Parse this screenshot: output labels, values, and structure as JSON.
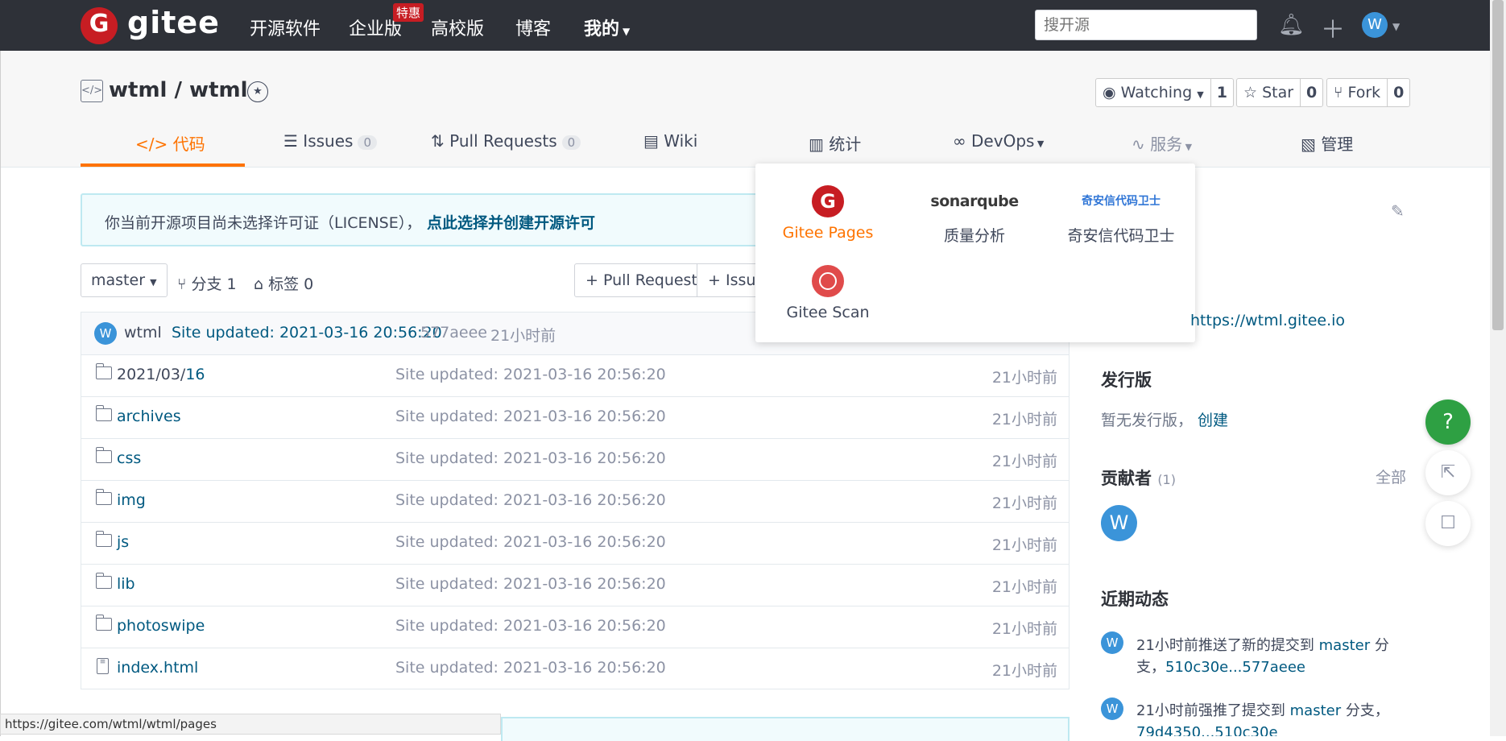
{
  "topbar": {
    "logo_letter": "G",
    "logo_text": "gitee",
    "nav": [
      "开源软件",
      "企业版",
      "高校版",
      "博客",
      "我的"
    ],
    "hot_badge": "特惠",
    "search_placeholder": "搜开源",
    "avatar_letter": "W"
  },
  "repo": {
    "title": "wtml / wtml",
    "watching_label": "Watching",
    "watching_count": "1",
    "star_label": "Star",
    "star_count": "0",
    "fork_label": "Fork",
    "fork_count": "0"
  },
  "tabs": [
    {
      "label": "代码",
      "icon": "code-icon"
    },
    {
      "label": "Issues",
      "count": "0"
    },
    {
      "label": "Pull Requests",
      "count": "0"
    },
    {
      "label": "Wiki"
    },
    {
      "label": "统计"
    },
    {
      "label": "DevOps"
    },
    {
      "label": "服务"
    },
    {
      "label": "管理"
    }
  ],
  "notice": {
    "text": "你当前开源项目尚未选择许可证（LICENSE），",
    "link": "点此选择并创建开源许可"
  },
  "branch": {
    "current": "master",
    "branches": "分支 1",
    "tags": "标签 0",
    "pr_button": "+ Pull Request",
    "issue_button": "+ Issue"
  },
  "commit": {
    "avatar": "W",
    "author": "wtml",
    "message": "Site updated: 2021-03-16 20:56:20",
    "hash": "577aeee",
    "time": "21小时前"
  },
  "files": [
    {
      "name_prefix": "2021/03/",
      "name": "16",
      "type": "folder",
      "message": "Site updated: 2021-03-16 20:56:20",
      "time": "21小时前"
    },
    {
      "name_prefix": "",
      "name": "archives",
      "type": "folder",
      "message": "Site updated: 2021-03-16 20:56:20",
      "time": "21小时前"
    },
    {
      "name_prefix": "",
      "name": "css",
      "type": "folder",
      "message": "Site updated: 2021-03-16 20:56:20",
      "time": "21小时前"
    },
    {
      "name_prefix": "",
      "name": "img",
      "type": "folder",
      "message": "Site updated: 2021-03-16 20:56:20",
      "time": "21小时前"
    },
    {
      "name_prefix": "",
      "name": "js",
      "type": "folder",
      "message": "Site updated: 2021-03-16 20:56:20",
      "time": "21小时前"
    },
    {
      "name_prefix": "",
      "name": "lib",
      "type": "folder",
      "message": "Site updated: 2021-03-16 20:56:20",
      "time": "21小时前"
    },
    {
      "name_prefix": "",
      "name": "photoswipe",
      "type": "folder",
      "message": "Site updated: 2021-03-16 20:56:20",
      "time": "21小时前"
    },
    {
      "name_prefix": "",
      "name": "index.html",
      "type": "file",
      "message": "Site updated: 2021-03-16 20:56:20",
      "time": "21小时前"
    }
  ],
  "services_dropdown": [
    {
      "label": "Gitee Pages"
    },
    {
      "label": "质量分析",
      "logo": "sonarqube"
    },
    {
      "label": "奇安信代码卫士",
      "logo": "奇安信代码卫士"
    },
    {
      "label": "Gitee Scan"
    }
  ],
  "sidebar": {
    "homepage_link": "https://wtml.gitee.io",
    "releases_title": "发行版",
    "releases_text": "暂无发行版，",
    "releases_create": "创建",
    "contributors_title": "贡献者",
    "contributors_count": "(1)",
    "contributors_all": "全部",
    "contributor_avatar": "W",
    "activity_title": "近期动态",
    "activities": [
      {
        "avatar": "W",
        "text_prefix": "21小时前推送了新的提交到 ",
        "branch": "master",
        "text_mid": " 分支，",
        "detail": "510c30e...577aeee"
      },
      {
        "avatar": "W",
        "text_prefix": "21小时前强推了提交到 ",
        "branch": "master",
        "text_mid": " 分支，",
        "detail": "79d4350...510c30e"
      }
    ]
  },
  "floating": {
    "help": "?"
  },
  "status_url": "https://gitee.com/wtml/wtml/pages",
  "colors": {
    "topbar": "#2e3138",
    "brand_red": "#c71d23",
    "active_orange": "#fe7300",
    "link_blue": "#005980",
    "help_green": "#2ea043"
  }
}
